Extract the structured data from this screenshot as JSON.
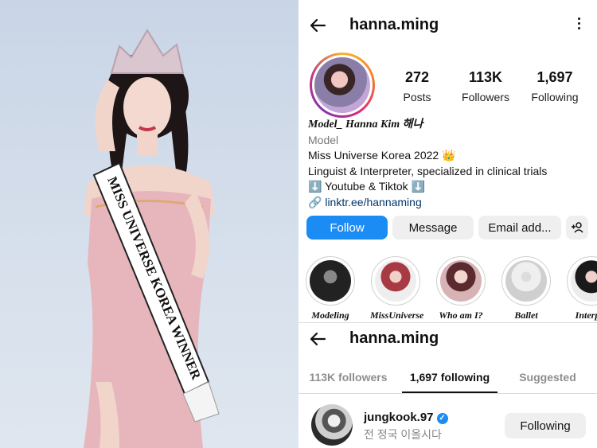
{
  "profile": {
    "username": "hanna.ming",
    "stats": [
      {
        "value": "272",
        "label": "Posts"
      },
      {
        "value": "113K",
        "label": "Followers"
      },
      {
        "value": "1,697",
        "label": "Following"
      }
    ],
    "display_name": "Model_ Hanna Kim 해나",
    "category": "Model",
    "bio_lines": [
      "Miss Universe Korea 2022 👑",
      "Linguist & Interpreter, specialized in clinical trials",
      "⬇️ Youtube & Tiktok ⬇️"
    ],
    "link": "linktr.ee/hannaming",
    "buttons": {
      "follow": "Follow",
      "message": "Message",
      "email": "Email add..."
    },
    "highlights": [
      "Modeling",
      "MissUniverse",
      "Who am I?",
      "Ballet",
      "Interpre"
    ]
  },
  "following_page": {
    "username": "hanna.ming",
    "tabs": [
      "113K followers",
      "1,697 following",
      "Suggested"
    ],
    "accounts": [
      {
        "username": "jungkook.97",
        "subtitle": "전 정국 이올시다",
        "button": "Following"
      }
    ]
  },
  "photo": {
    "sash_text": "MISS UNIVERSE KOREA WINNER"
  },
  "colors": {
    "accent": "#1c8cf5",
    "link": "#00376b"
  }
}
